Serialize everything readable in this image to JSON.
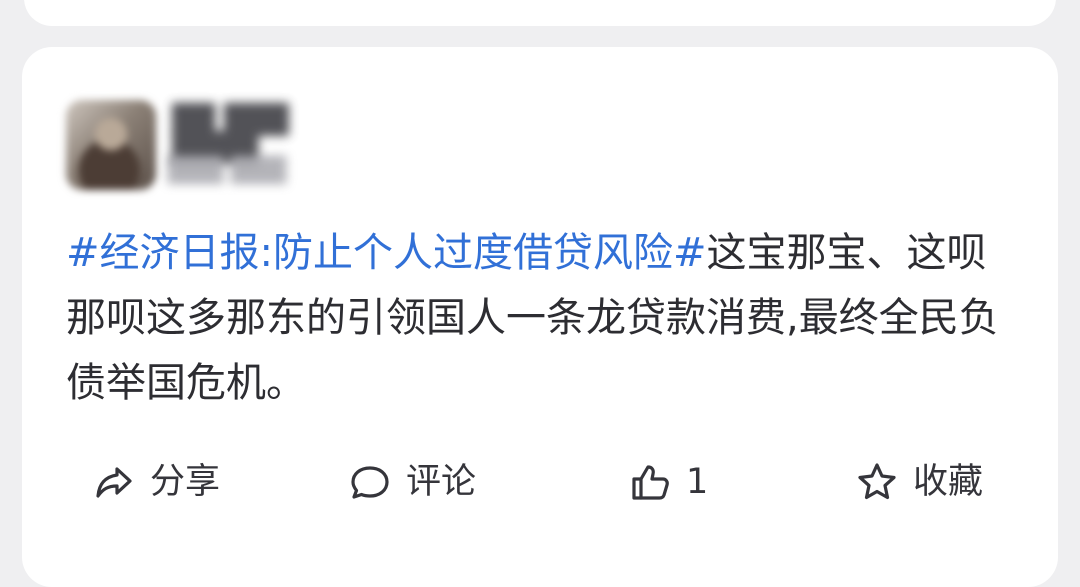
{
  "post": {
    "topic": "#经济日报:防止个人过度借贷风险#",
    "body": "这宝那宝、这呗那呗这多那东的引领国人一条龙贷款消费,最终全民负债举国危机。"
  },
  "actions": {
    "share": "分享",
    "comment": "评论",
    "like_count": "1",
    "favorite": "收藏"
  },
  "icons": {
    "share": "share-arrow-icon",
    "comment": "chat-bubble-icon",
    "like": "thumbs-up-icon",
    "favorite": "star-icon"
  },
  "colors": {
    "topic": "#3170d7",
    "text": "#2d2d32",
    "card": "#ffffff",
    "background": "#efeff1"
  }
}
